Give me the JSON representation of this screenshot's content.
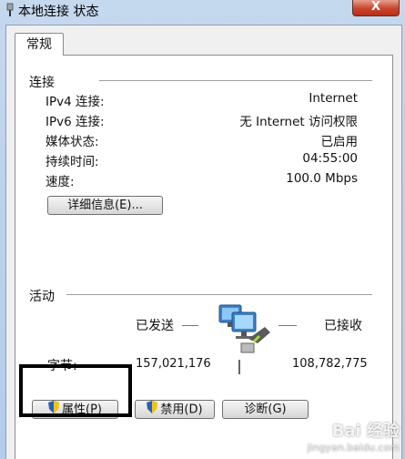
{
  "window": {
    "title": "本地连接 状态",
    "close_glyph": "X"
  },
  "tab": {
    "label": "常规"
  },
  "connection": {
    "heading": "连接",
    "rows": [
      {
        "label": "IPv4 连接:",
        "value": "Internet"
      },
      {
        "label": "IPv6 连接:",
        "value": "无 Internet 访问权限"
      },
      {
        "label": "媒体状态:",
        "value": "已启用"
      },
      {
        "label": "持续时间:",
        "value": "04:55:00"
      },
      {
        "label": "速度:",
        "value": "100.0 Mbps"
      }
    ],
    "details_button": "详细信息(E)..."
  },
  "activity": {
    "heading": "活动",
    "sent_label": "已发送",
    "received_label": "已接收",
    "bytes_label": "字节:",
    "sent_bytes": "157,021,176",
    "received_bytes": "108,782,775"
  },
  "buttons": {
    "properties": "属性(P)",
    "disable": "禁用(D)",
    "diagnose": "诊断(G)"
  },
  "watermark": {
    "main": "Bai 经验",
    "sub": "jingyan.baidu.com"
  },
  "colors": {
    "titlebar": "#b9d1ea",
    "close": "#c8452e",
    "highlight": "#000000"
  }
}
